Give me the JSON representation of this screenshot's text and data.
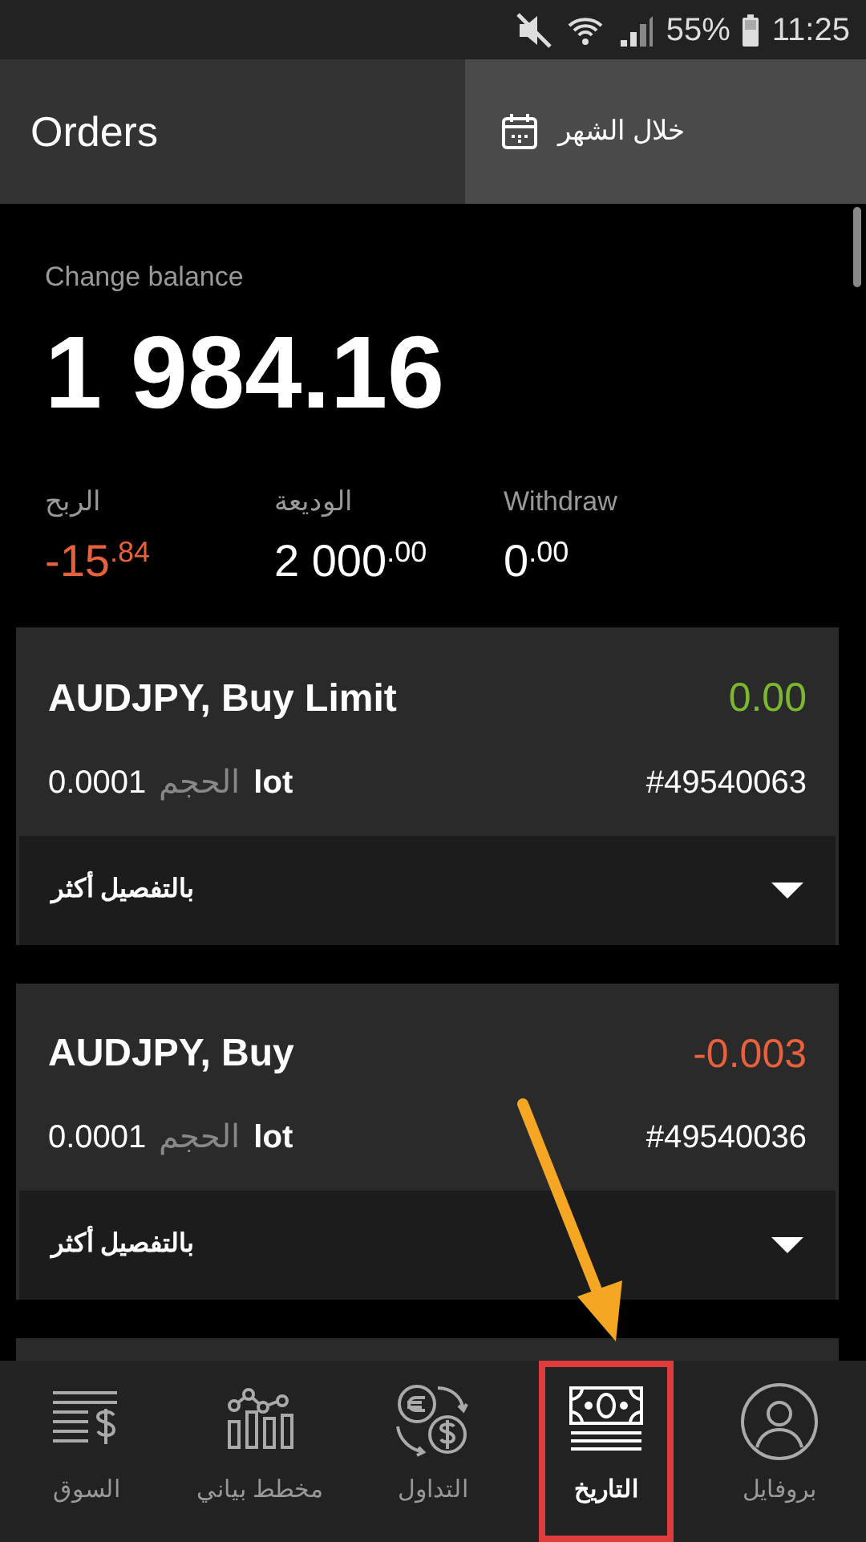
{
  "status_bar": {
    "battery": "55%",
    "time": "11:25"
  },
  "header": {
    "title": "Orders",
    "period": "خلال الشهر"
  },
  "summary": {
    "label": "Change balance",
    "balance": "1 984.16",
    "stats": [
      {
        "label": "Withdraw",
        "value": "0$^{.00}$",
        "kind": "plain"
      },
      {
        "label": "الوديعة",
        "value": "2 000$^{.00}$",
        "kind": "plain"
      },
      {
        "label": "الربح",
        "value": "-15$^{.84}$",
        "kind": "loss"
      }
    ]
  },
  "orders": [
    {
      "title": "AUDJPY, Buy Limit",
      "profit": "0.00",
      "kind": "gain",
      "lot_value": "0.0001",
      "lot_label": "الحجم",
      "lot_unit": "lot",
      "ticket": "#49540063",
      "more": "بالتفصيل أكثر",
      "expanded": false
    },
    {
      "title": "AUDJPY, Buy",
      "profit": "-0.003",
      "kind": "loss",
      "lot_value": "0.0001",
      "lot_label": "الحجم",
      "lot_unit": "lot",
      "ticket": "#49540036",
      "more": "بالتفصيل أكثر",
      "expanded": false
    }
  ],
  "nav": [
    {
      "label": "بروفايل",
      "kind": "profile",
      "selected": false,
      "highlighted": false
    },
    {
      "label": "التاريخ",
      "kind": "money",
      "selected": true,
      "highlighted": true
    },
    {
      "label": "التداول",
      "kind": "exchange",
      "selected": false,
      "highlighted": false
    },
    {
      "label": "مخطط بياني",
      "kind": "chart",
      "selected": false,
      "highlighted": false
    },
    {
      "label": "السوق",
      "kind": "market",
      "selected": false,
      "highlighted": false
    }
  ],
  "pointer_arrow": true
}
